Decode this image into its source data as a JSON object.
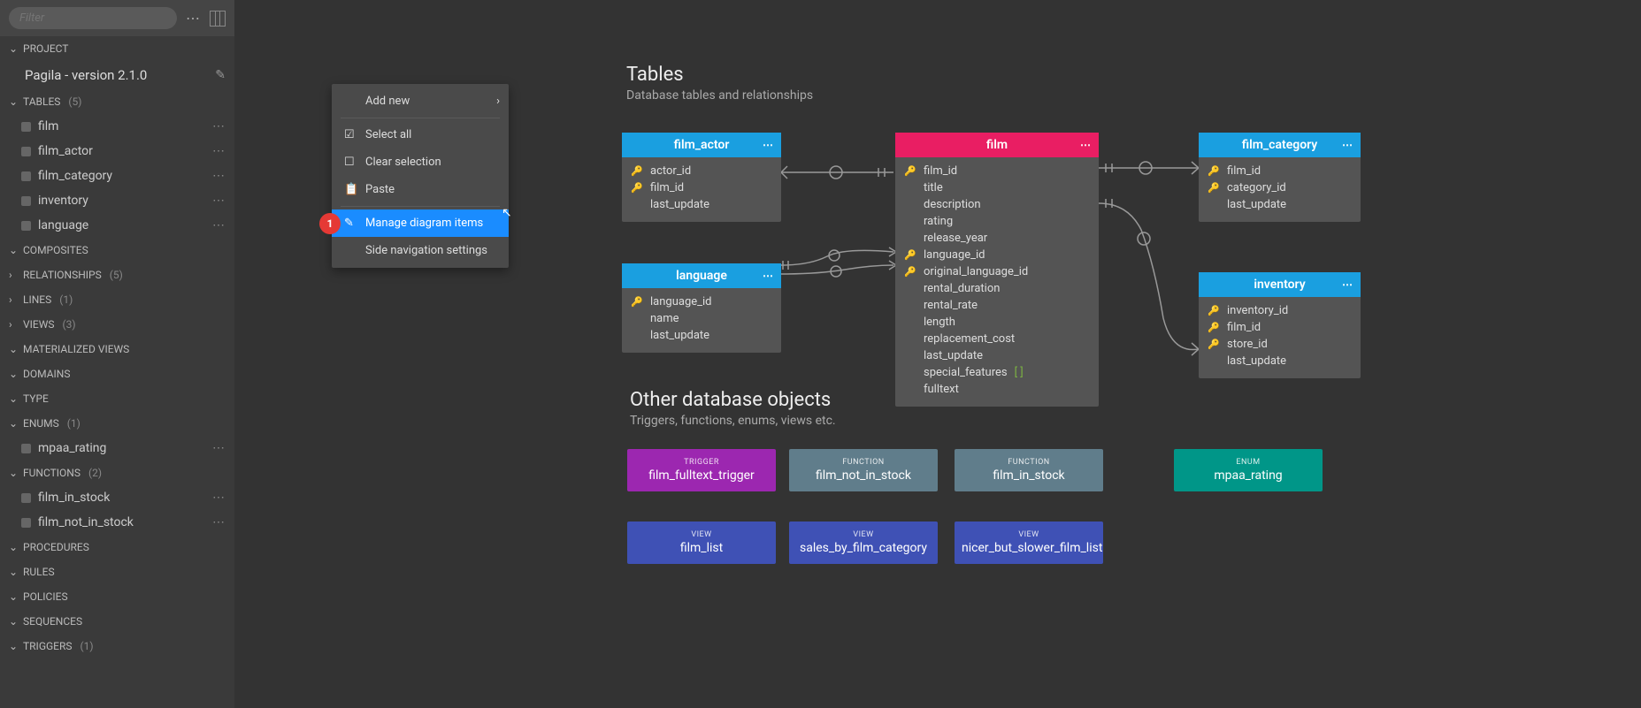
{
  "filter": {
    "placeholder": "Filter"
  },
  "sidebar": {
    "project_header": "PROJECT",
    "project_name": "Pagila - version 2.1.0",
    "sections": [
      {
        "label": "TABLES",
        "count": "(5)",
        "expanded": true,
        "items": [
          {
            "label": "film"
          },
          {
            "label": "film_actor"
          },
          {
            "label": "film_category"
          },
          {
            "label": "inventory"
          },
          {
            "label": "language"
          }
        ]
      },
      {
        "label": "COMPOSITES",
        "expanded": true,
        "items": []
      },
      {
        "label": "RELATIONSHIPS",
        "count": "(5)",
        "expanded": false
      },
      {
        "label": "LINES",
        "count": "(1)",
        "expanded": false
      },
      {
        "label": "VIEWS",
        "count": "(3)",
        "expanded": false
      },
      {
        "label": "MATERIALIZED VIEWS",
        "expanded": true,
        "items": []
      },
      {
        "label": "DOMAINS",
        "expanded": true,
        "items": []
      },
      {
        "label": "TYPE",
        "expanded": true,
        "items": []
      },
      {
        "label": "ENUMS",
        "count": "(1)",
        "expanded": true,
        "items": [
          {
            "label": "mpaa_rating"
          }
        ]
      },
      {
        "label": "FUNCTIONS",
        "count": "(2)",
        "expanded": true,
        "items": [
          {
            "label": "film_in_stock"
          },
          {
            "label": "film_not_in_stock"
          }
        ]
      },
      {
        "label": "PROCEDURES",
        "expanded": true,
        "items": []
      },
      {
        "label": "RULES",
        "expanded": true,
        "items": []
      },
      {
        "label": "POLICIES",
        "expanded": true,
        "items": []
      },
      {
        "label": "SEQUENCES",
        "expanded": true,
        "items": []
      },
      {
        "label": "TRIGGERS",
        "count": "(1)",
        "expanded": true,
        "items": []
      }
    ]
  },
  "context_menu": {
    "add_new": "Add new",
    "select_all": "Select all",
    "clear_selection": "Clear selection",
    "paste": "Paste",
    "manage": "Manage diagram items",
    "side_nav": "Side navigation settings",
    "step_badge": "1"
  },
  "diagram": {
    "tables_title": "Tables",
    "tables_subtitle": "Database tables and relationships",
    "other_title": "Other database objects",
    "other_subtitle": "Triggers, functions, enums, views etc.",
    "tables": {
      "film_actor": {
        "name": "film_actor",
        "cols": [
          {
            "name": "actor_id",
            "key": "pk"
          },
          {
            "name": "film_id",
            "key": "pkfk"
          },
          {
            "name": "last_update"
          }
        ]
      },
      "film": {
        "name": "film",
        "cols": [
          {
            "name": "film_id",
            "key": "pk"
          },
          {
            "name": "title"
          },
          {
            "name": "description"
          },
          {
            "name": "rating"
          },
          {
            "name": "release_year"
          },
          {
            "name": "language_id",
            "key": "fk"
          },
          {
            "name": "original_language_id",
            "key": "fk"
          },
          {
            "name": "rental_duration"
          },
          {
            "name": "rental_rate"
          },
          {
            "name": "length"
          },
          {
            "name": "replacement_cost"
          },
          {
            "name": "last_update"
          },
          {
            "name": "special_features",
            "array": true
          },
          {
            "name": "fulltext"
          }
        ]
      },
      "film_category": {
        "name": "film_category",
        "cols": [
          {
            "name": "film_id",
            "key": "pkfk"
          },
          {
            "name": "category_id",
            "key": "pk"
          },
          {
            "name": "last_update"
          }
        ]
      },
      "language": {
        "name": "language",
        "cols": [
          {
            "name": "language_id",
            "key": "pk"
          },
          {
            "name": "name"
          },
          {
            "name": "last_update"
          }
        ]
      },
      "inventory": {
        "name": "inventory",
        "cols": [
          {
            "name": "inventory_id",
            "key": "pk"
          },
          {
            "name": "film_id",
            "key": "pkfk"
          },
          {
            "name": "store_id",
            "key": "pk"
          },
          {
            "name": "last_update"
          }
        ]
      }
    },
    "objects": [
      {
        "type": "TRIGGER",
        "name": "film_fulltext_trigger",
        "color": "purple"
      },
      {
        "type": "FUNCTION",
        "name": "film_not_in_stock",
        "color": "slate"
      },
      {
        "type": "FUNCTION",
        "name": "film_in_stock",
        "color": "slate"
      },
      {
        "type": "ENUM",
        "name": "mpaa_rating",
        "color": "teal"
      },
      {
        "type": "VIEW",
        "name": "film_list",
        "color": "indigo"
      },
      {
        "type": "VIEW",
        "name": "sales_by_film_category",
        "color": "indigo"
      },
      {
        "type": "VIEW",
        "name": "nicer_but_slower_film_list",
        "color": "indigo"
      }
    ]
  }
}
